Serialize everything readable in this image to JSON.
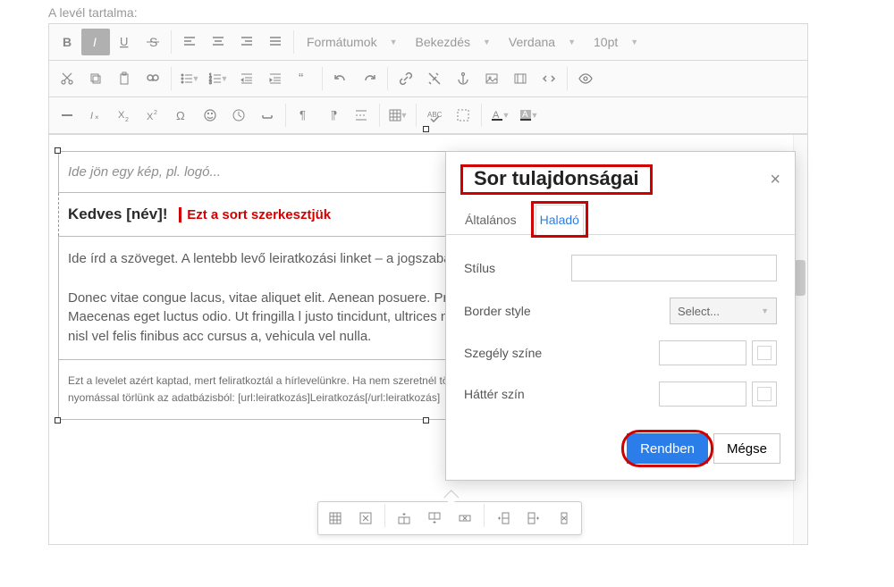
{
  "page": {
    "label": "A levél tartalma:"
  },
  "toolbar": {
    "dropdowns": {
      "formats": "Formátumok",
      "paragraph": "Bekezdés",
      "font_family": "Verdana",
      "font_size": "10pt"
    },
    "icons": {
      "bold": "bold-icon",
      "italic": "italic-icon",
      "underline": "underline-icon",
      "strike": "strike-icon",
      "align_left": "align-left-icon",
      "align_center": "align-center-icon",
      "align_right": "align-right-icon",
      "align_justify": "align-justify-icon",
      "cut": "cut-icon",
      "copy": "copy-icon",
      "paste": "paste-icon",
      "find": "find-icon",
      "ul": "bullet-list-icon",
      "ol": "number-list-icon",
      "outdent": "outdent-icon",
      "indent": "indent-icon",
      "blockquote": "blockquote-icon",
      "undo": "undo-icon",
      "redo": "redo-icon",
      "link": "link-icon",
      "unlink": "unlink-icon",
      "anchor": "anchor-icon",
      "image": "image-icon",
      "media": "media-icon",
      "code": "code-icon",
      "preview": "preview-icon",
      "hr": "hr-icon",
      "remove_format": "clear-format-icon",
      "sub": "subscript-icon",
      "sup": "superscript-icon",
      "omega": "special-char-icon",
      "emoji": "emoji-icon",
      "datetime": "datetime-icon",
      "nbsp": "nbsp-icon",
      "ltr": "ltr-icon",
      "rtl": "rtl-icon",
      "pagebreak": "pagebreak-icon",
      "table": "table-icon",
      "spellcheck": "spellcheck-icon",
      "show_blocks": "show-blocks-icon",
      "text_color": "text-color-icon",
      "bg_color": "bg-color-icon"
    }
  },
  "content": {
    "logo_placeholder": "Ide jön egy kép, pl. logó...",
    "greeting": "Kedves [név]!",
    "edit_note": "Ezt a sort szerkesztjük",
    "body_p1": "Ide írd a szöveget. A lentebb levő leiratkozási linket – a jogszabályok szerint kötelező is feltüntetni a hírleve…",
    "body_p2": "Donec vitae congue lacus, vitae aliquet elit. Aenean posuere. Proin vel sem magna. Pellentesque diam t eget turpis. Maecenas eget luctus odio. Ut fringilla l justo tincidunt, ultrices nulla vitae, blandit ipsum. P tortor hendrerit a. Donec in nisl vel felis finibus acc cursus a, vehicula vel nulla.",
    "footer": "Ezt a levelet azért kaptad, mert feliratkoztál a hírlevelünkre. Ha nem szeretnél több ilyen emailt kapni, az alábbi linkre kattintva egyetlen gomb nyomással törlünk az adatbázisból: [url:leiratkozás]Leiratkozás[/url:leiratkozás]"
  },
  "table_popup": {
    "icons": [
      "table-icon",
      "delete-table-icon",
      "row-before-icon",
      "row-after-icon",
      "delete-row-icon",
      "col-before-icon",
      "col-after-icon",
      "delete-col-icon"
    ]
  },
  "dialog": {
    "title": "Sor tulajdonságai",
    "tabs": {
      "general": "Általános",
      "advanced": "Haladó"
    },
    "fields": {
      "style": "Stílus",
      "border_style": "Border style",
      "border_style_value": "Select...",
      "border_color": "Szegély színe",
      "bg_color": "Háttér szín"
    },
    "buttons": {
      "ok": "Rendben",
      "cancel": "Mégse"
    }
  }
}
